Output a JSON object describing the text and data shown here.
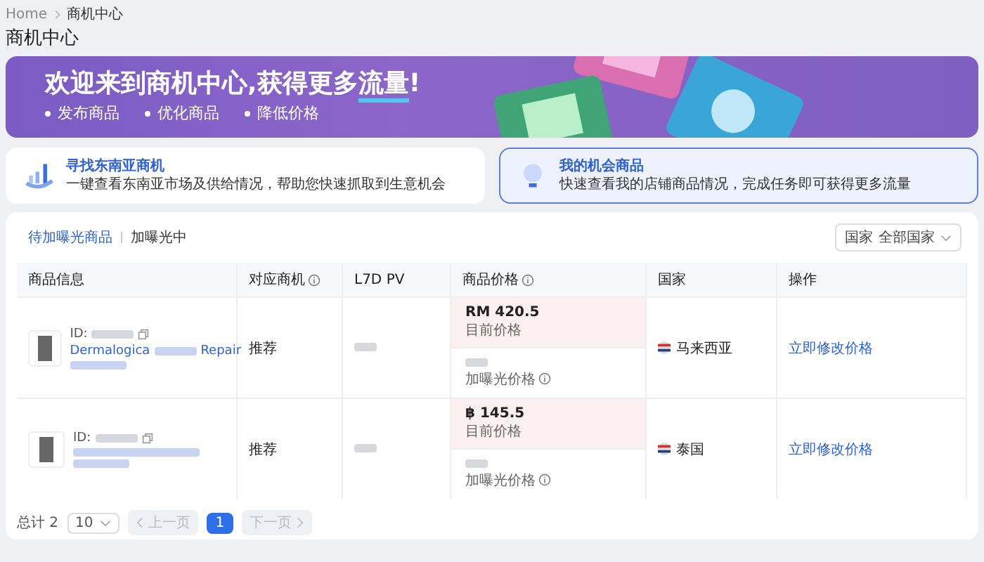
{
  "breadcrumb": [
    {
      "label": "Home"
    },
    {
      "label": "商机中心"
    }
  ],
  "page_title": "商机中心",
  "banner": {
    "title_before": "欢迎来到商机中心,获得更多",
    "title_highlight": "流量",
    "title_after": "!",
    "bullets": [
      "发布商品",
      "优化商品",
      "降低价格"
    ]
  },
  "cards": [
    {
      "title": "寻找东南亚商机",
      "description": "一键查看东南亚市场及供给情况，帮助您快速抓取到生意机会",
      "selected": false
    },
    {
      "title": "我的机会商品",
      "description": "快速查看我的店铺商品情况，完成任务即可获得更多流量",
      "selected": true
    }
  ],
  "tabs": [
    {
      "label": "待加曝光商品",
      "selected": true
    },
    {
      "label": "加曝光中",
      "selected": false
    }
  ],
  "country_filter": {
    "label": "国家",
    "value": "全部国家"
  },
  "table": {
    "columns": [
      {
        "label": "商品信息",
        "info": false
      },
      {
        "label": "对应商机",
        "info": true
      },
      {
        "label": "L7D PV",
        "info": false
      },
      {
        "label": "商品价格",
        "info": true
      },
      {
        "label": "国家",
        "info": false
      },
      {
        "label": "操作",
        "info": false
      }
    ],
    "rows": [
      {
        "id_label": "ID:",
        "name_visible": [
          "Dermalogica",
          "Repair"
        ],
        "opportunity": "推荐",
        "current_price": "RM 420.5",
        "current_price_label": "目前价格",
        "boost_price_label": "加曝光价格",
        "country": "马来西亚",
        "action": "立即修改价格"
      },
      {
        "id_label": "ID:",
        "name_visible": [],
        "opportunity": "推荐",
        "current_price": "฿ 145.5",
        "current_price_label": "目前价格",
        "boost_price_label": "加曝光价格",
        "country": "泰国",
        "action": "立即修改价格"
      }
    ]
  },
  "pagination": {
    "total": "总计 2",
    "page_size": "10",
    "prev": "上一页",
    "next": "下一页",
    "prev_disabled": true,
    "next_disabled": true,
    "pages": [
      {
        "label": "1",
        "selected": true
      }
    ]
  }
}
